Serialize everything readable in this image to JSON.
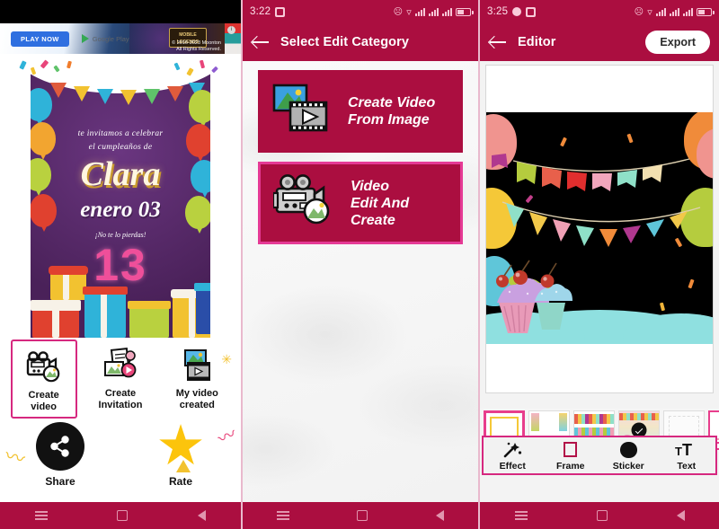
{
  "panels": [
    {
      "id": "home",
      "ad": {
        "cta": "PLAY NOW",
        "store": "Google Play",
        "copyright": "© 2016-2023 Moonton",
        "rights": "All Rights Reserved.",
        "brand": "MOBILE LEGENDS",
        "close_icon": "info-icon"
      },
      "card": {
        "line1": "te invitamos a celebrar",
        "line2": "el cumpleaños  de",
        "name": "Clara",
        "date": "enero 03",
        "tagline": "¡No te lo pierdas!",
        "age": "13"
      },
      "actions": [
        {
          "label": "Create video",
          "icon": "video-camera-image-icon",
          "selected": true
        },
        {
          "label": "Create Invitation",
          "icon": "invitation-card-icon",
          "selected": false
        },
        {
          "label": "My video created",
          "icon": "image-filmstrip-icon",
          "selected": false
        }
      ],
      "bottom_actions": [
        {
          "label": "Share",
          "icon": "share-icon"
        },
        {
          "label": "Rate",
          "icon": "star-icon"
        }
      ],
      "navbar": [
        "recents-icon",
        "home-icon",
        "back-icon"
      ]
    },
    {
      "id": "select-edit-category",
      "status": {
        "time": "",
        "icons": [
          "mute-icon",
          "wifi-icon",
          "signal-icon",
          "signal-icon",
          "signal-icon",
          "battery-icon"
        ]
      },
      "appbar": {
        "back_icon": "back-arrow-icon",
        "title": "Select Edit Category"
      },
      "categories": [
        {
          "label_line1": "Create Video",
          "label_line2": "From Image",
          "icon": "image-to-video-icon",
          "selected": false
        },
        {
          "label_line1": "Video",
          "label_line2": "Edit And Create",
          "icon": "video-camera-image-icon",
          "selected": true
        }
      ],
      "navbar": [
        "recents-icon",
        "home-icon",
        "back-icon"
      ]
    },
    {
      "id": "editor",
      "appbar": {
        "back_icon": "back-arrow-icon",
        "title": "Editor",
        "export_label": "Export"
      },
      "thumbs_count": 6,
      "selected_thumb_index": 3,
      "tools": [
        {
          "label": "Effect",
          "icon": "magic-wand-icon"
        },
        {
          "label": "Frame",
          "icon": "frame-square-icon"
        },
        {
          "label": "Sticker",
          "icon": "sticker-blob-icon"
        },
        {
          "label": "Text",
          "icon": "text-size-icon"
        }
      ],
      "navbar": [
        "recents-icon",
        "home-icon",
        "back-icon"
      ]
    }
  ],
  "status_bars": [
    {
      "time": "",
      "icons": [
        "mute-icon",
        "wifi-icon",
        "signal-icon",
        "signal-icon",
        "battery-icon"
      ]
    },
    {
      "time": "3:22",
      "icons": [
        "mute-icon",
        "wifi-icon",
        "signal-icon",
        "signal-icon",
        "battery-icon"
      ]
    },
    {
      "time": "3:25",
      "icons": [
        "mute-icon",
        "wifi-icon",
        "signal-icon",
        "signal-icon",
        "battery-icon"
      ]
    }
  ],
  "colors": {
    "brand": "#ab0e40",
    "accent_pink": "#d6287f",
    "accent_pink_bright": "#e53a95",
    "card_purple": "#5a2b6e",
    "star_yellow": "#fcc40c",
    "canvas_black": "#000000",
    "canvas_teal": "#8fe0e0"
  }
}
